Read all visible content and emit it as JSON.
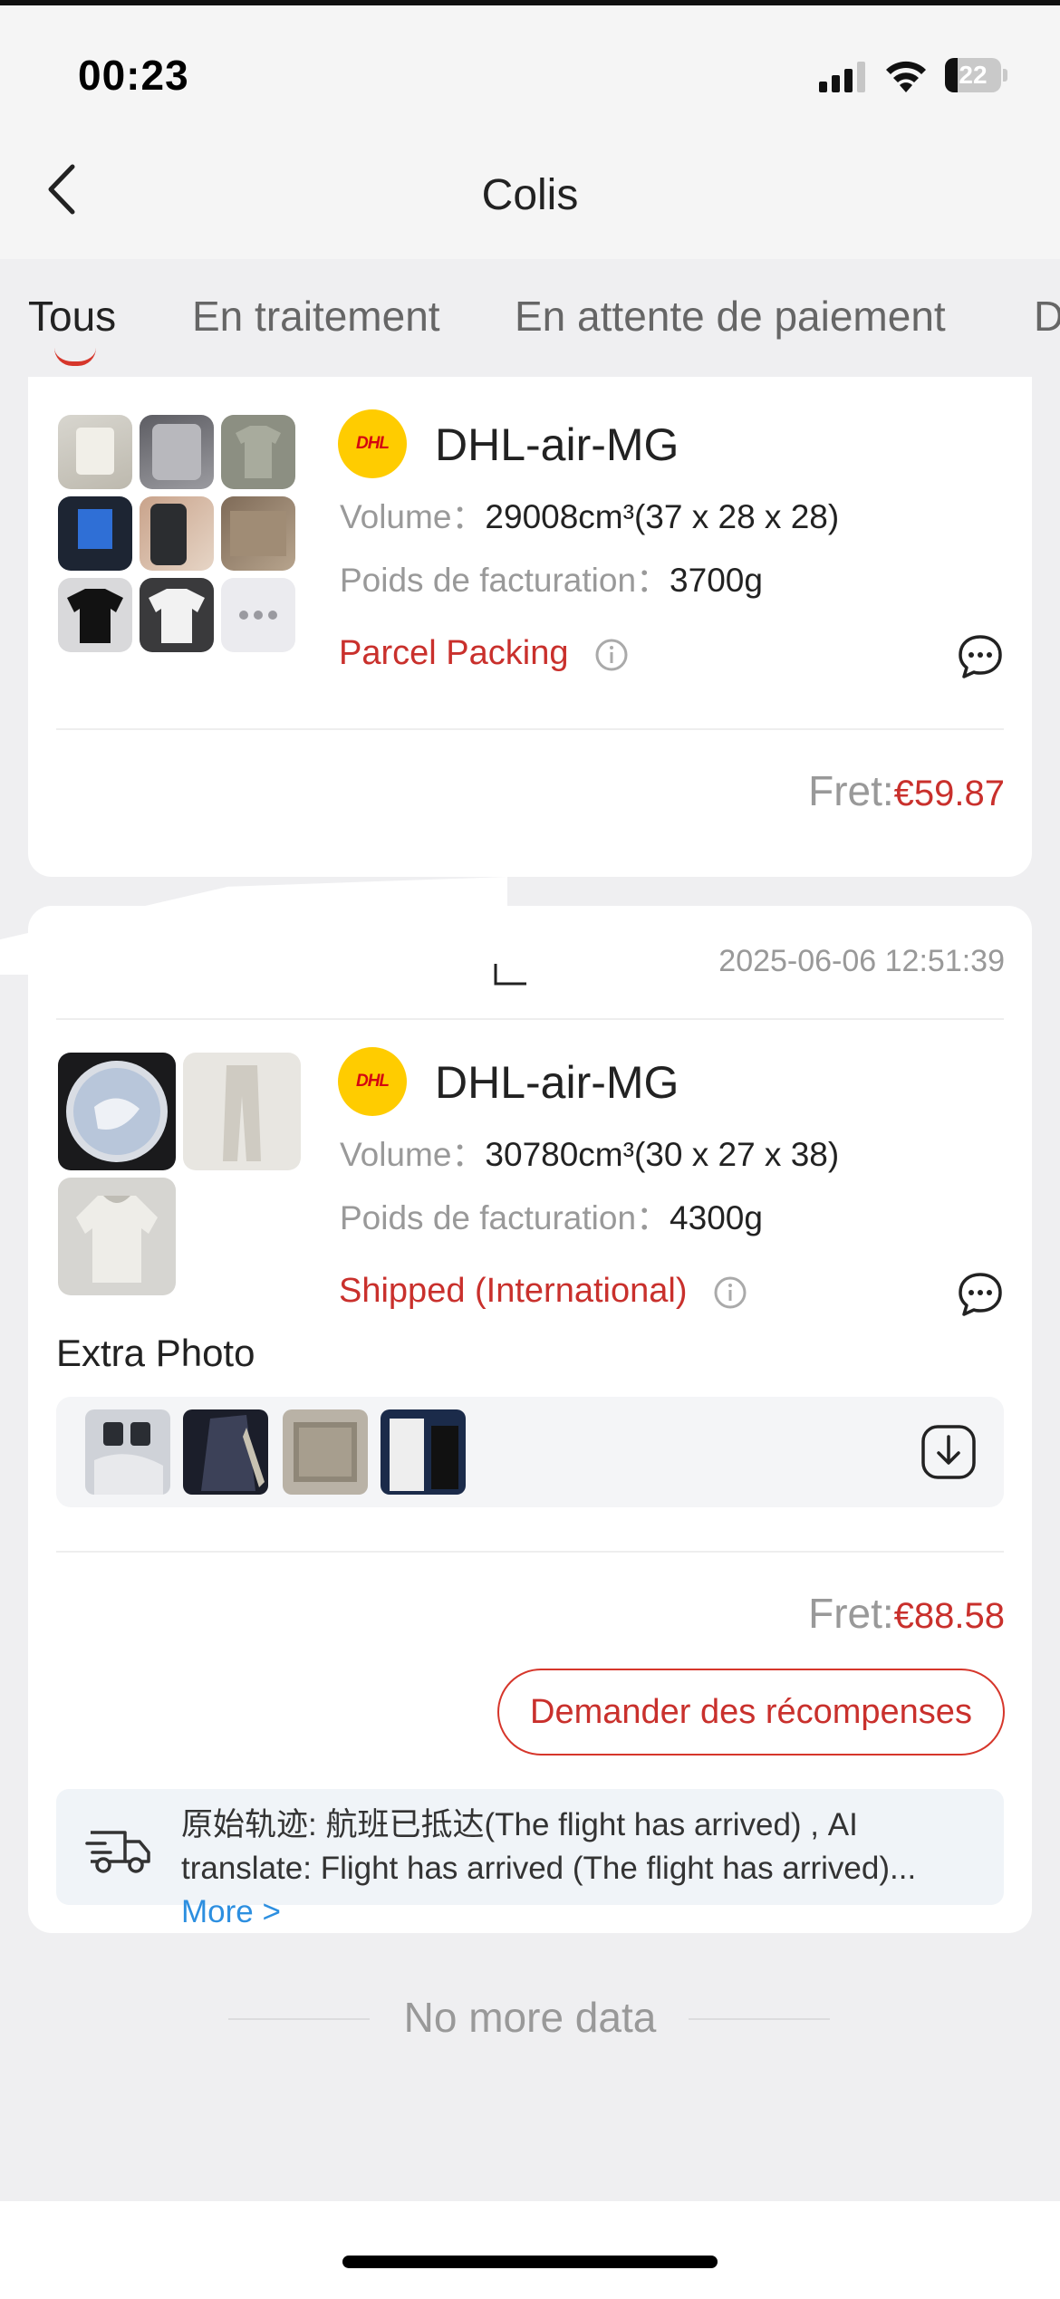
{
  "status_bar": {
    "time": "00:23",
    "battery": "22"
  },
  "nav": {
    "title": "Colis"
  },
  "tabs": [
    {
      "label": "Tous",
      "active": true
    },
    {
      "label": "En traitement"
    },
    {
      "label": "En attente de paiement"
    },
    {
      "label": "D"
    }
  ],
  "parcels": [
    {
      "carrier": "DHL-air-MG",
      "carrier_logo_text": "DHL",
      "volume_label": "Volume：",
      "volume_value": "29008cm³(37 x 28 x 28)",
      "weight_label": "Poids de facturation：",
      "weight_value": "3700g",
      "status": "Parcel Packing",
      "fret_label": "Fret:",
      "fret_amount": "€59.87"
    },
    {
      "date": "2025-06-06 12:51:39",
      "carrier": "DHL-air-MG",
      "carrier_logo_text": "DHL",
      "volume_label": "Volume：",
      "volume_value": "30780cm³(30 x 27 x 38)",
      "weight_label": "Poids de facturation：",
      "weight_value": "4300g",
      "status": "Shipped (International)",
      "extra_photo_title": "Extra Photo",
      "fret_label": "Fret:",
      "fret_amount": "€88.58",
      "reward_button": "Demander des récompenses",
      "tracking_text": "原始轨迹: 航班已抵达(The flight has arrived) , AI translate: Flight has arrived (The flight has arrived)...",
      "tracking_more": "More >"
    }
  ],
  "footer": {
    "no_more": "No more data"
  },
  "colors": {
    "accent_red": "#c9302c",
    "link_blue": "#2d8fe0",
    "dhl_yellow": "#ffcc00"
  }
}
